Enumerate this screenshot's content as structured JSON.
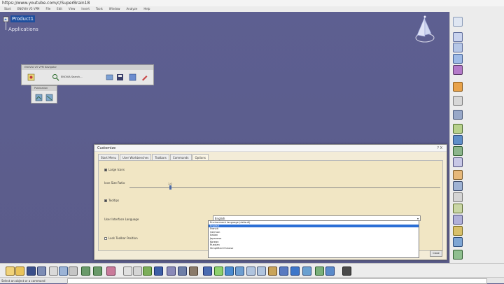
{
  "url": "https://www.youtube.com/c/SuperBrain18",
  "menu": [
    "Start",
    "ENOVIA V5 VPM",
    "File",
    "Edit",
    "View",
    "Insert",
    "Tools",
    "Window",
    "Analyze",
    "Help"
  ],
  "tree": {
    "root": "Product1",
    "child": "Applications"
  },
  "nav_toolbar": {
    "title": "ENOVIA V5 VPM Navigator",
    "search_label": "ENOVIA Search..."
  },
  "small_toolbar": {
    "title": "Publication"
  },
  "dialog": {
    "title": "Customize",
    "controls": "?  X",
    "tabs": [
      "Start Menu",
      "User Workbenches",
      "Toolbars",
      "Commands",
      "Options"
    ],
    "active_tab": "Options",
    "large_icons_label": "Large Icons",
    "icon_size_label": "Icon Size Ratio",
    "icon_size_value": "1.0",
    "tooltips_label": "Tooltips",
    "language_label": "User Interface Language",
    "language_value": "English",
    "lock_toolbar_label": "Lock Toolbar Position",
    "close_label": "Close",
    "language_options": [
      "Environment language (default)",
      "English",
      "French",
      "German",
      "Italian",
      "Japanese",
      "Korean",
      "Russian",
      "Simplified Chinese"
    ],
    "selected_language": "English"
  },
  "status": {
    "text": "Select an object or a command"
  }
}
